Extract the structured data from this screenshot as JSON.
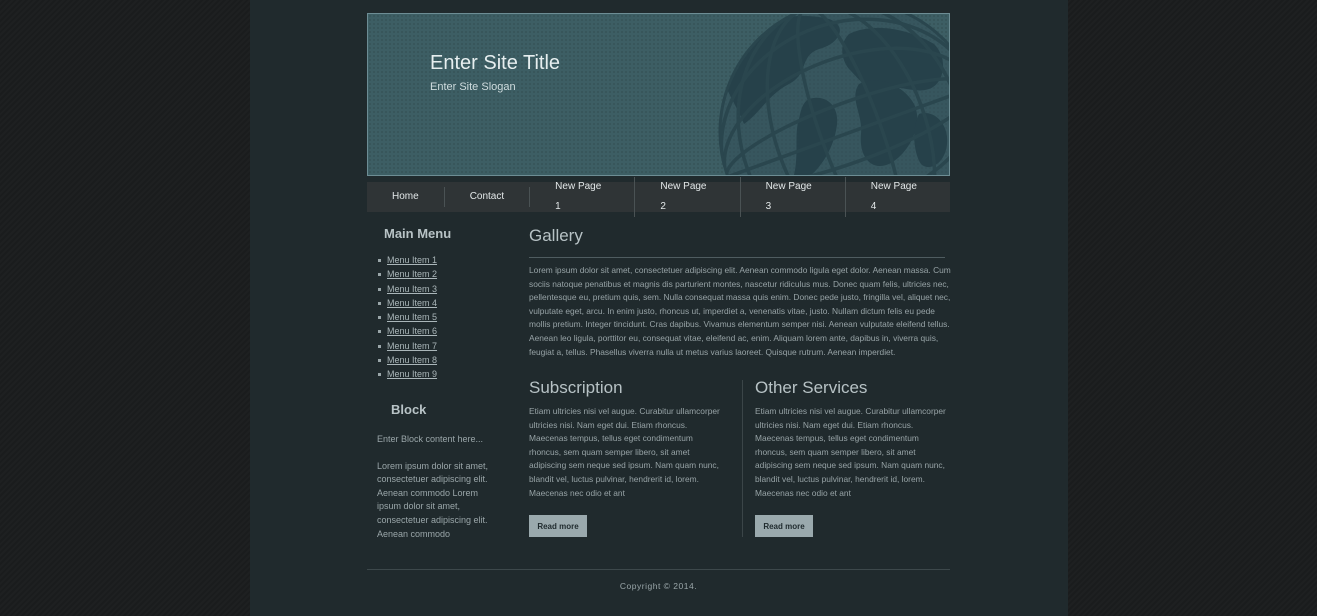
{
  "header": {
    "site_title": "Enter Site Title",
    "site_slogan": "Enter Site Slogan"
  },
  "nav": {
    "items": [
      "Home",
      "Contact",
      "New Page 1",
      "New Page 2",
      "New Page 3",
      "New Page 4"
    ]
  },
  "sidebar": {
    "menu_heading": "Main Menu",
    "menu_items": [
      "Menu Item 1",
      "Menu Item 2",
      "Menu Item 3",
      "Menu Item 4",
      "Menu Item 5",
      "Menu Item 6",
      "Menu Item 7",
      "Menu Item 8",
      "Menu Item 9"
    ],
    "block_heading": "Block",
    "block_intro": "Enter Block content here...",
    "block_body": "Lorem ipsum dolor sit amet, consectetuer adipiscing elit. Aenean commodo Lorem ipsum dolor sit amet, consectetuer adipiscing elit. Aenean commodo"
  },
  "main": {
    "gallery_title": "Gallery",
    "gallery_text": "Lorem ipsum dolor sit amet, consectetuer adipiscing elit. Aenean commodo ligula eget dolor. Aenean massa. Cum sociis natoque penatibus et magnis dis parturient montes, nascetur ridiculus mus. Donec quam felis, ultricies nec, pellentesque eu, pretium quis, sem. Nulla consequat massa quis enim. Donec pede justo, fringilla vel, aliquet nec, vulputate eget, arcu. In enim justo, rhoncus ut, imperdiet a, venenatis vitae, justo. Nullam dictum felis eu pede mollis pretium. Integer tincidunt. Cras dapibus. Vivamus elementum semper nisi. Aenean vulputate eleifend tellus. Aenean leo ligula, porttitor eu, consequat vitae, eleifend ac, enim. Aliquam lorem ante, dapibus in, viverra quis, feugiat a, tellus. Phasellus viverra nulla ut metus varius laoreet. Quisque rutrum. Aenean imperdiet.",
    "subscription": {
      "title": "Subscription",
      "text": "Etiam ultricies nisi vel augue. Curabitur ullamcorper ultricies nisi. Nam eget dui. Etiam rhoncus. Maecenas tempus, tellus eget condimentum rhoncus, sem quam semper libero, sit amet adipiscing sem neque sed ipsum. Nam quam nunc, blandit vel, luctus pulvinar, hendrerit id, lorem. Maecenas nec odio et ant",
      "button": "Read more"
    },
    "other_services": {
      "title": "Other Services",
      "text": "Etiam ultricies nisi vel augue. Curabitur ullamcorper ultricies nisi. Nam eget dui. Etiam rhoncus. Maecenas tempus, tellus eget condimentum rhoncus, sem quam semper libero, sit amet adipiscing sem neque sed ipsum. Nam quam nunc, blandit vel, luctus pulvinar, hendrerit id, lorem. Maecenas nec odio et ant",
      "button": "Read more"
    }
  },
  "footer": {
    "copyright": "Copyright © 2014."
  },
  "colors": {
    "page_background": "#1d1f20",
    "content_background": "#202a2d",
    "header_teal": "#3d5e64",
    "nav_background": "#2f3436",
    "button_background": "#9aa9ad"
  },
  "icons": {
    "header_graphic": "globe-icon"
  }
}
